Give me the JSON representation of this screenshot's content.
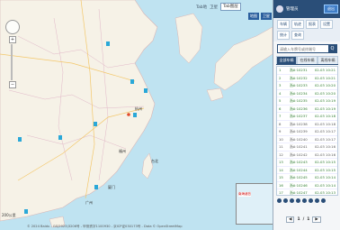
{
  "map": {
    "topbar": {
      "label1": "Tab地",
      "label2": "卫星",
      "select": "Tab图层"
    },
    "top_buttons": [
      "地图",
      "卫星"
    ],
    "scale_label": "200公里",
    "copyright": "© 2024 Baidu - GS(2023)3206号 - 甲测资字1100930 - 京ICP证030173号 - Data © OpenStreetMap",
    "inset_label": "南海诸岛",
    "place_labels": [
      "杭州",
      "福州",
      "厦门",
      "广州",
      "台北"
    ],
    "colors": {
      "sea": "#bfe3f1",
      "land": "#f6f2e7",
      "border": "#d8b5b5",
      "road": "#f3c76a",
      "marker": "#2aa8d8"
    }
  },
  "panel": {
    "user": "管理员",
    "logout": "退出",
    "menu": [
      "车辆",
      "轨迹",
      "报表",
      "设置",
      "统计",
      "查询"
    ],
    "search_placeholder": "请输入车牌号或终端号",
    "search_btn": "Q",
    "tabs": [
      "全部车辆",
      "在线车辆",
      "离线车辆"
    ],
    "rows": [
      {
        "id": "1",
        "name": "浙A·10231",
        "time": "02-03 10:21",
        "online": true
      },
      {
        "id": "2",
        "name": "浙A·10232",
        "time": "02-03 10:21",
        "online": true
      },
      {
        "id": "3",
        "name": "浙A·10233",
        "time": "02-03 10:20",
        "online": true
      },
      {
        "id": "4",
        "name": "浙A·10234",
        "time": "02-03 10:20",
        "online": true
      },
      {
        "id": "5",
        "name": "浙A·10235",
        "time": "02-03 10:19",
        "online": true
      },
      {
        "id": "6",
        "name": "浙A·10236",
        "time": "02-03 10:19",
        "online": true
      },
      {
        "id": "7",
        "name": "浙A·10237",
        "time": "02-03 10:18",
        "online": true
      },
      {
        "id": "8",
        "name": "浙A·10238",
        "time": "02-03 10:18",
        "online": false
      },
      {
        "id": "9",
        "name": "浙A·10239",
        "time": "02-03 10:17",
        "online": false
      },
      {
        "id": "10",
        "name": "浙A·10240",
        "time": "02-03 10:17",
        "online": false
      },
      {
        "id": "11",
        "name": "浙A·10241",
        "time": "02-03 10:16",
        "online": false
      },
      {
        "id": "12",
        "name": "浙A·10242",
        "time": "02-03 10:16",
        "online": false
      },
      {
        "id": "13",
        "name": "浙A·10243",
        "time": "02-03 10:15",
        "online": true
      },
      {
        "id": "14",
        "name": "浙A·10244",
        "time": "02-03 10:15",
        "online": true
      },
      {
        "id": "15",
        "name": "浙A·10245",
        "time": "02-03 10:14",
        "online": true
      },
      {
        "id": "16",
        "name": "浙A·10246",
        "time": "02-03 10:14",
        "online": true
      },
      {
        "id": "17",
        "name": "浙A·10247",
        "time": "02-03 10:13",
        "online": true
      },
      {
        "id": "18",
        "name": "浙A·10248",
        "time": "02-03 10:13",
        "online": true
      },
      {
        "id": "19",
        "name": "浙A·10249",
        "time": "02-03 10:12",
        "online": true
      }
    ],
    "pager": {
      "prev": "◀",
      "page": "1",
      "sep": "/",
      "total": "1",
      "next": "▶"
    }
  }
}
